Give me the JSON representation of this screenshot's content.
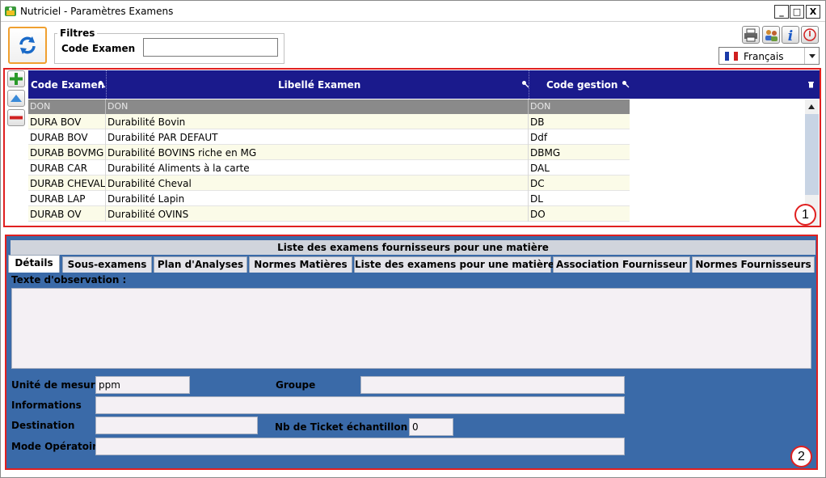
{
  "window": {
    "title": "Nutriciel - Paramètres Examens",
    "controls": [
      "_",
      "□",
      "X"
    ]
  },
  "toolbar": {
    "refresh_icon": "refresh-arrows-icon",
    "filters_legend": "Filtres",
    "code_label": "Code Examen",
    "code_value": "",
    "icons": [
      "print-icon",
      "users-icon",
      "info-icon",
      "power-icon"
    ],
    "language": "Français"
  },
  "grid": {
    "columns": [
      "Code Examen",
      "Libellé Examen",
      "Code gestion"
    ],
    "filters": [
      "DON",
      "DON",
      "DON"
    ],
    "rows": [
      [
        "DURA BOV",
        "Durabilité Bovin",
        "DB"
      ],
      [
        "DURAB BOV",
        "Durabilité PAR DEFAUT",
        "Ddf"
      ],
      [
        "DURAB BOVMG",
        "Durabilité BOVINS riche en MG",
        "DBMG"
      ],
      [
        "DURAB CAR",
        "Durabilité Aliments à la carte",
        "DAL"
      ],
      [
        "DURAB CHEVAL",
        "Durabilité Cheval",
        "DC"
      ],
      [
        "DURAB LAP",
        "Durabilité Lapin",
        "DL"
      ],
      [
        "DURAB OV",
        "Durabilité OVINS",
        "DO"
      ]
    ],
    "badge": "1"
  },
  "details": {
    "section_title": "Liste des examens fournisseurs pour une matière",
    "tabs": [
      "Détails",
      "Sous-examens",
      "Plan d'Analyses",
      "Normes Matières",
      "Liste des examens pour une matière",
      "Association Fournisseur",
      "Normes Fournisseurs"
    ],
    "observation_label": "Texte d'observation :",
    "observation_value": "",
    "unit_label": "Unité de mesure",
    "unit_value": "ppm",
    "group_label": "Groupe",
    "group_value": "",
    "info_label": "Informations",
    "info_value": "",
    "destination_label": "Destination",
    "destination_value": "",
    "ticket_label": "Nb de Ticket échantillon",
    "ticket_value": "0",
    "mode_label": "Mode Opératoire",
    "mode_value": "",
    "badge": "2"
  },
  "colors": {
    "header_blue": "#1a1a8c",
    "panel_blue": "#3a6aa8",
    "highlight_red": "#e02020",
    "row_alt": "#fbfbe8"
  }
}
